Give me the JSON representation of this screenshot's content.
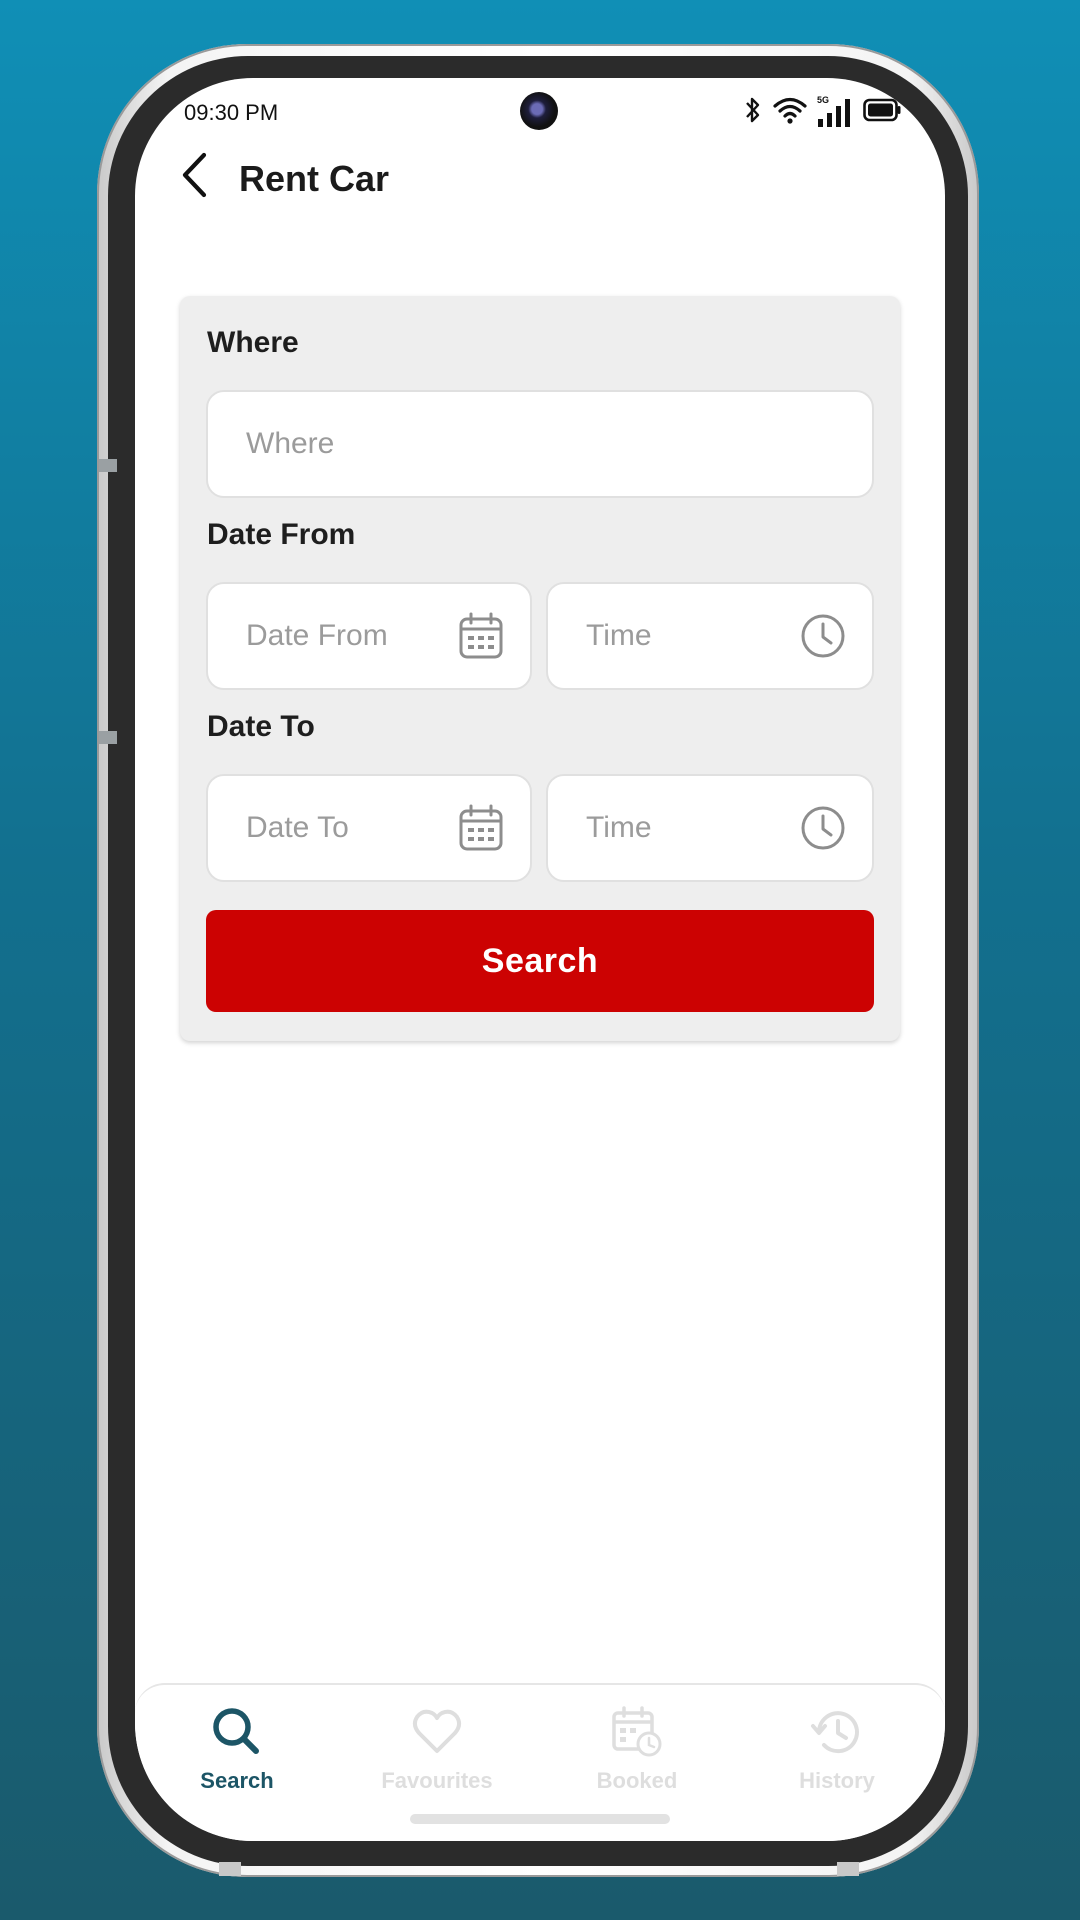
{
  "status_bar": {
    "time": "09:30 PM",
    "network_label": "5G",
    "icons": [
      "bluetooth-icon",
      "wifi-icon",
      "signal-icon",
      "battery-icon"
    ]
  },
  "header": {
    "back_icon": "chevron-left-icon",
    "title": "Rent Car"
  },
  "form": {
    "where": {
      "label": "Where",
      "placeholder": "Where"
    },
    "date_from": {
      "label": "Date From",
      "date_placeholder": "Date From",
      "time_placeholder": "Time",
      "date_icon": "calendar-icon",
      "time_icon": "clock-icon"
    },
    "date_to": {
      "label": "Date To",
      "date_placeholder": "Date To",
      "time_placeholder": "Time",
      "date_icon": "calendar-icon",
      "time_icon": "clock-icon"
    },
    "search_label": "Search"
  },
  "bottom_nav": {
    "items": [
      {
        "label": "Search",
        "icon": "search-icon",
        "active": true
      },
      {
        "label": "Favourites",
        "icon": "heart-icon",
        "active": false
      },
      {
        "label": "Booked",
        "icon": "calendar-clock-icon",
        "active": false
      },
      {
        "label": "History",
        "icon": "history-icon",
        "active": false
      }
    ]
  },
  "colors": {
    "background_top": "#108fb6",
    "background_bottom": "#1a5a6c",
    "primary_button": "#cc0202",
    "nav_active": "#1c5566",
    "nav_inactive": "#dedede",
    "card_background": "#eeeeee",
    "placeholder": "#9b9b9b"
  }
}
